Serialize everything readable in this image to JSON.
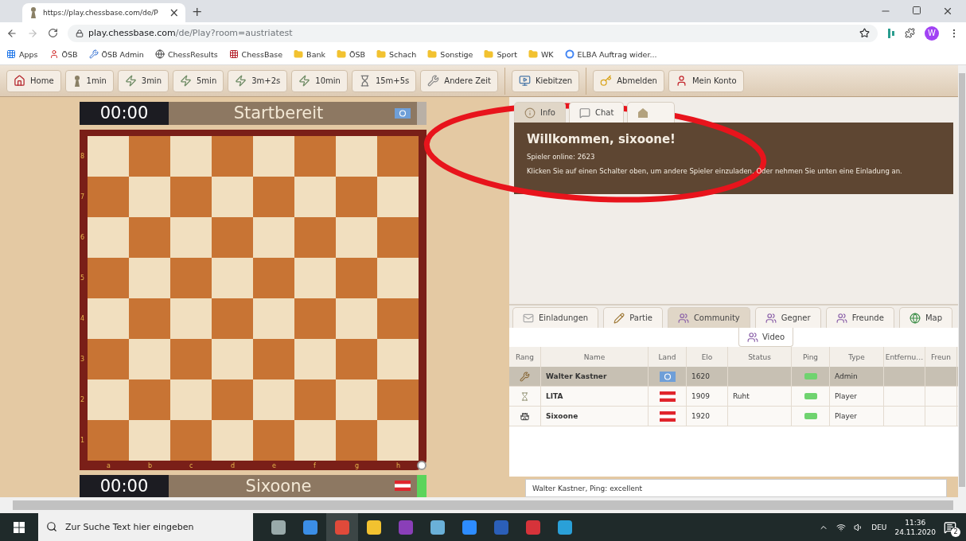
{
  "browser": {
    "tab_title": "https://play.chessbase.com/de/P",
    "tab_close": "×",
    "new_tab": "+",
    "url_host": "play.chessbase.com",
    "url_path": "/de/Play?room=austriatest",
    "profile_initial": "W",
    "bookmarks": [
      {
        "label": "Apps",
        "kind": "apps"
      },
      {
        "label": "ÖSB",
        "kind": "club"
      },
      {
        "label": "ÖSB Admin",
        "kind": "admin"
      },
      {
        "label": "ChessResults",
        "kind": "globe"
      },
      {
        "label": "ChessBase",
        "kind": "board"
      },
      {
        "label": "Bank",
        "kind": "folder"
      },
      {
        "label": "ÖSB",
        "kind": "folder"
      },
      {
        "label": "Schach",
        "kind": "folder"
      },
      {
        "label": "Sonstige",
        "kind": "folder"
      },
      {
        "label": "Sport",
        "kind": "folder"
      },
      {
        "label": "WK",
        "kind": "folder"
      },
      {
        "label": "ELBA Auftrag wider...",
        "kind": "g"
      }
    ]
  },
  "toolbar": {
    "groups": [
      [
        {
          "label": "Home",
          "kind": "home"
        },
        {
          "label": "1min",
          "kind": "pawn"
        },
        {
          "label": "3min",
          "kind": "bolt"
        },
        {
          "label": "5min",
          "kind": "bolt"
        },
        {
          "label": "3m+2s",
          "kind": "bolt"
        },
        {
          "label": "10min",
          "kind": "bolt"
        },
        {
          "label": "15m+5s",
          "kind": "hourglass"
        },
        {
          "label": "Andere Zeit",
          "kind": "wrench"
        }
      ],
      [
        {
          "label": "Kiebitzen",
          "kind": "screen"
        }
      ],
      [
        {
          "label": "Abmelden",
          "kind": "key"
        },
        {
          "label": "Mein Konto",
          "kind": "user"
        }
      ]
    ]
  },
  "board": {
    "top_clock": {
      "time": "00:00",
      "name": "Startbereit",
      "flag": {
        "kind": "un"
      },
      "active": false
    },
    "bottom_clock": {
      "time": "00:00",
      "name": "Sixoone",
      "flag": {
        "kind": "at"
      },
      "active": true
    },
    "ranks": [
      "8",
      "7",
      "6",
      "5",
      "4",
      "3",
      "2",
      "1"
    ],
    "files": [
      "a",
      "b",
      "c",
      "d",
      "e",
      "f",
      "g",
      "h"
    ]
  },
  "panel": {
    "tabs": [
      {
        "label": "Info",
        "kind": "info",
        "selected": true
      },
      {
        "label": "Chat",
        "kind": "chat",
        "selected": false
      },
      {
        "kind": "club",
        "selected": false
      }
    ],
    "welcome": {
      "title": "Willkommen, sixoone!",
      "online": "Spieler online: 2623",
      "hint": "Klicken Sie auf einen Schalter oben, um andere Spieler einzuladen. Oder nehmen Sie unten eine Einladung an."
    },
    "section_tabs": [
      {
        "label": "Einladungen",
        "kind": "mail",
        "selected": false
      },
      {
        "label": "Partie",
        "kind": "pencil",
        "selected": false
      },
      {
        "label": "Community",
        "kind": "users",
        "selected": true
      },
      {
        "label": "Gegner",
        "kind": "users",
        "selected": false
      },
      {
        "label": "Freunde",
        "kind": "users",
        "selected": false
      },
      {
        "label": "Map",
        "kind": "globe",
        "selected": false
      }
    ],
    "sub_tabs": [
      {
        "label": "Video",
        "kind": "users",
        "selected": false
      }
    ],
    "table": {
      "columns": [
        "Rang",
        "Name",
        "Land",
        "Elo",
        "Status",
        "Ping",
        "Type",
        "Entfernu…",
        "Freun"
      ],
      "rows": [
        {
          "rank": {
            "kind": "admin"
          },
          "name": "Walter Kastner",
          "flag": {
            "kind": "un"
          },
          "elo": "1620",
          "status": "",
          "ping": {
            "kind": "good"
          },
          "type": "Admin",
          "selected": true
        },
        {
          "rank": {
            "kind": "pawn"
          },
          "name": "LITA",
          "flag": {
            "kind": "at"
          },
          "elo": "1909",
          "status": "Ruht",
          "ping": {
            "kind": "good"
          },
          "type": "Player",
          "selected": false
        },
        {
          "rank": {
            "kind": "rook"
          },
          "name": "Sixoone",
          "flag": {
            "kind": "at"
          },
          "elo": "1920",
          "status": "",
          "ping": {
            "kind": "good"
          },
          "type": "Player",
          "selected": false
        }
      ]
    },
    "status": "Walter Kastner, Ping: excellent"
  },
  "annotation": {
    "kind": "ellipse",
    "color": "#e8141c"
  },
  "taskbar": {
    "search_placeholder": "Zur Suche Text hier eingeben",
    "apps": [
      {
        "kind": "taskview",
        "active": false
      },
      {
        "kind": "mail",
        "active": false
      },
      {
        "kind": "chrome",
        "active": true
      },
      {
        "kind": "folder",
        "active": false
      },
      {
        "kind": "note",
        "active": false
      },
      {
        "kind": "pad",
        "active": false
      },
      {
        "kind": "camera",
        "active": false
      },
      {
        "kind": "doc",
        "active": false
      },
      {
        "kind": "ball",
        "active": false
      },
      {
        "kind": "edge",
        "active": false
      }
    ],
    "language": "DEU",
    "time": "11:36",
    "date": "24.11.2020",
    "notifications": "2"
  }
}
